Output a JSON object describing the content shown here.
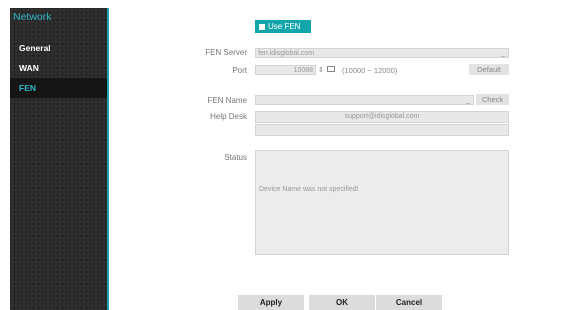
{
  "sidebar": {
    "title": "Network",
    "items": [
      {
        "label": "General"
      },
      {
        "label": "WAN"
      },
      {
        "label": "FEN"
      }
    ]
  },
  "fen": {
    "use_fen_label": "Use FEN",
    "use_fen_checked": true,
    "fen_server_label": "FEN Server",
    "fen_server_value": "fen.idisglobal.com",
    "port_label": "Port",
    "port_value": "10088",
    "port_range": "(10000 ~ 12000)",
    "default_label": "Default",
    "fen_name_label": "FEN Name",
    "fen_name_value": "",
    "check_label": "Check",
    "help_desk_label": "Help Desk",
    "help_desk_value": "support@idisglobal.com",
    "help_desk_value2": "",
    "status_label": "Status",
    "status_text": "Device Name was not specified!"
  },
  "footer": {
    "apply_label": "Apply",
    "ok_label": "OK",
    "cancel_label": "Cancel"
  },
  "colors": {
    "accent": "#1aa3b0",
    "button_teal": "#12a5a9",
    "sidebar_bg": "#2a2a2a"
  },
  "icons": {
    "spinner": "up-down-arrows-icon",
    "keyboard": "keyboard-icon",
    "dropdown": "chevron-down-icon"
  }
}
